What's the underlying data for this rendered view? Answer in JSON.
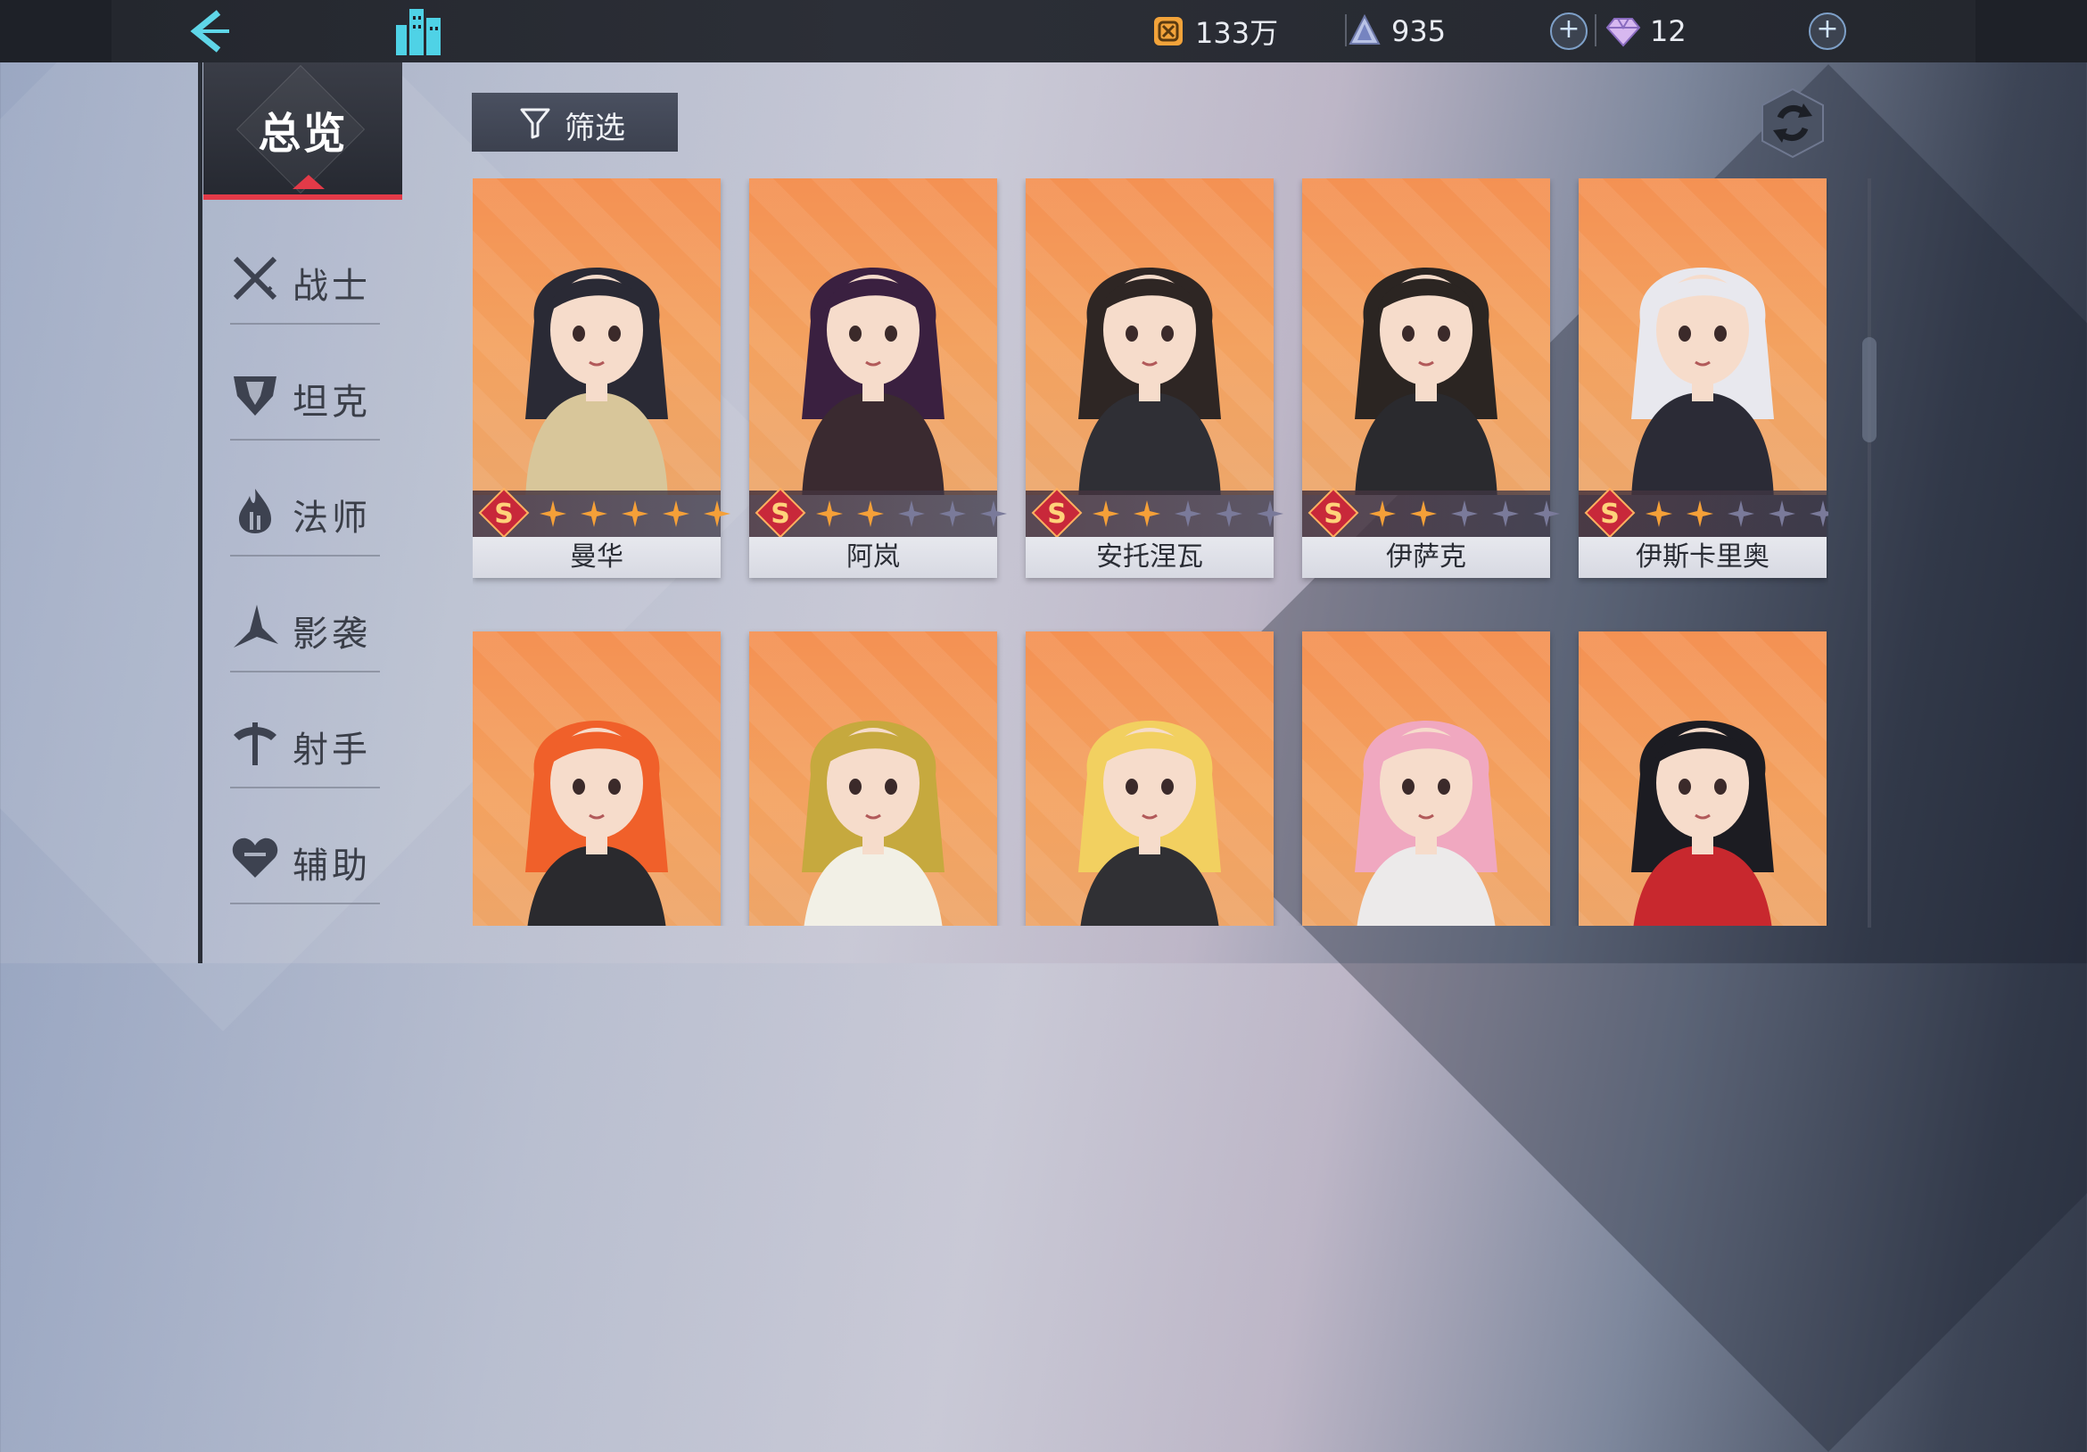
{
  "topbar": {
    "back_icon": "back-arrow-icon",
    "city_icon": "city-buildings-icon",
    "gold": {
      "icon": "gold-coin-icon",
      "value": "133万"
    },
    "stamina": {
      "icon": "stamina-crystal-icon",
      "value": "935"
    },
    "gems": {
      "icon": "diamond-gem-icon",
      "value": "12"
    },
    "plus_label": "+"
  },
  "sidebar": {
    "overview": "总览",
    "categories": [
      {
        "label": "战士",
        "icon": "crossed-swords-icon"
      },
      {
        "label": "坦克",
        "icon": "shield-armor-icon"
      },
      {
        "label": "法师",
        "icon": "magic-flame-icon"
      },
      {
        "label": "影袭",
        "icon": "shadow-blade-icon"
      },
      {
        "label": "射手",
        "icon": "crossbow-icon"
      },
      {
        "label": "辅助",
        "icon": "heart-icon"
      }
    ]
  },
  "filter": {
    "label": "筛选",
    "icon": "funnel-filter-icon"
  },
  "refresh_icon": "refresh-cycle-icon",
  "colors": {
    "accent": "#e33a48",
    "card_bg": "#f49153",
    "star_lit": "#f5a038",
    "star_dim": "#7a7a9a"
  },
  "heroes": [
    {
      "name": "曼华",
      "rank": "S",
      "stars": 5,
      "hair": "#2a2a35",
      "outfit": "#d8c69a"
    },
    {
      "name": "阿岚",
      "rank": "S",
      "stars": 2,
      "hair": "#3a2040",
      "outfit": "#3a2a30"
    },
    {
      "name": "安托涅瓦",
      "rank": "S",
      "stars": 2,
      "hair": "#2e2624",
      "outfit": "#2f2f35"
    },
    {
      "name": "伊萨克",
      "rank": "S",
      "stars": 2,
      "hair": "#2b2522",
      "outfit": "#2a2a2e"
    },
    {
      "name": "伊斯卡里奥",
      "rank": "S",
      "stars": 2,
      "hair": "#e8e8ee",
      "outfit": "#2b2b36"
    },
    {
      "name": "",
      "rank": "",
      "stars": 0,
      "hair": "#f0602a",
      "outfit": "#2a2a2e"
    },
    {
      "name": "",
      "rank": "",
      "stars": 0,
      "hair": "#c6a93e",
      "outfit": "#f2f0e6"
    },
    {
      "name": "",
      "rank": "",
      "stars": 0,
      "hair": "#f2d060",
      "outfit": "#303034"
    },
    {
      "name": "",
      "rank": "",
      "stars": 0,
      "hair": "#f0a8c0",
      "outfit": "#eceaea"
    },
    {
      "name": "",
      "rank": "",
      "stars": 0,
      "hair": "#1c1c22",
      "outfit": "#c8282e"
    }
  ]
}
